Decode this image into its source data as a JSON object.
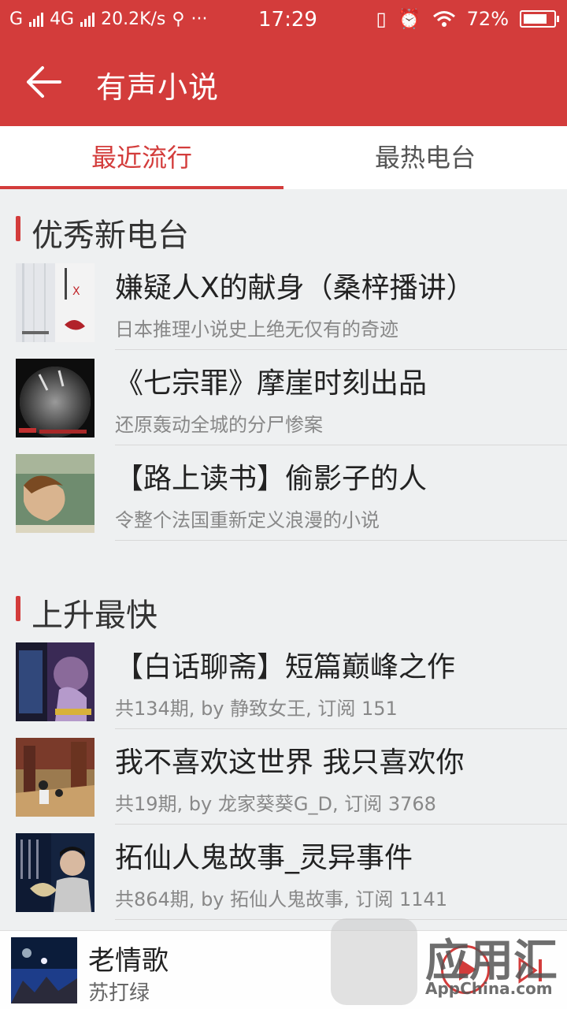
{
  "status": {
    "carrier": "G",
    "network": "4G",
    "speed": "20.2K/s",
    "more": "···",
    "time": "17:29",
    "battery": "72%"
  },
  "header": {
    "title": "有声小说"
  },
  "tabs": [
    {
      "label": "最近流行",
      "active": true
    },
    {
      "label": "最热电台",
      "active": false
    }
  ],
  "sections": [
    {
      "title": "优秀新电台",
      "items": [
        {
          "title": "嫌疑人X的献身（桑梓播讲）",
          "subtitle": "日本推理小说史上绝无仅有的奇迹"
        },
        {
          "title": "《七宗罪》摩崖时刻出品",
          "subtitle": "还原轰动全城的分尸惨案"
        },
        {
          "title": "【路上读书】偷影子的人",
          "subtitle": "令整个法国重新定义浪漫的小说"
        }
      ]
    },
    {
      "title": "上升最快",
      "items": [
        {
          "title": "【白话聊斋】短篇巅峰之作",
          "subtitle": "共134期, by 静致女王, 订阅 151"
        },
        {
          "title": "我不喜欢这世界 我只喜欢你",
          "subtitle": "共19期, by 龙家葵葵G_D, 订阅 3768"
        },
        {
          "title": "拓仙人鬼故事_灵异事件",
          "subtitle": "共864期, by 拓仙人鬼故事, 订阅 1141"
        }
      ]
    }
  ],
  "player": {
    "title": "老情歌",
    "artist": "苏打绿"
  },
  "watermark": {
    "name": "应用汇",
    "domain": "AppChina.com"
  },
  "colors": {
    "accent": "#d33c3b"
  }
}
